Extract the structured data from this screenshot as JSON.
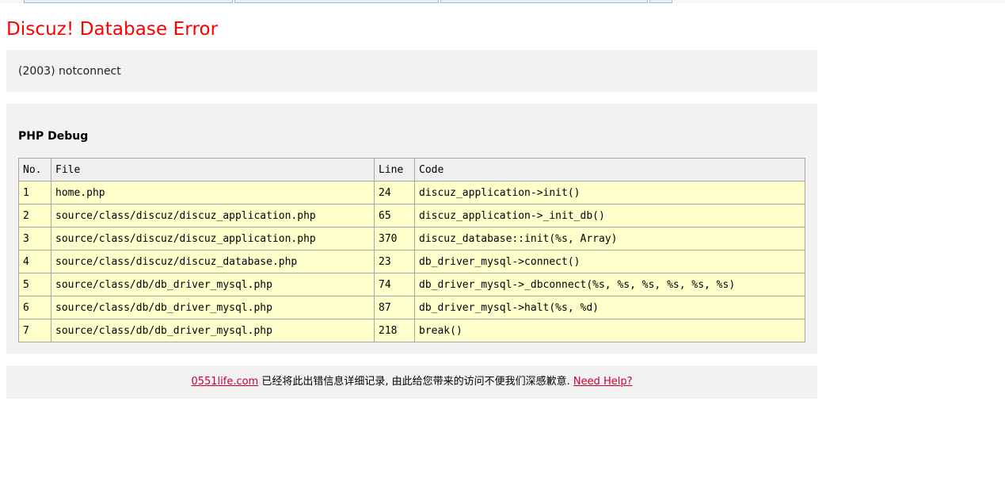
{
  "page": {
    "title": "Discuz! Database Error",
    "error_message": "(2003) notconnect"
  },
  "debug": {
    "title": "PHP Debug",
    "columns": [
      "No.",
      "File",
      "Line",
      "Code"
    ],
    "rows": [
      {
        "no": "1",
        "file": "home.php",
        "line": "24",
        "code": "discuz_application->init()"
      },
      {
        "no": "2",
        "file": "source/class/discuz/discuz_application.php",
        "line": "65",
        "code": "discuz_application->_init_db()"
      },
      {
        "no": "3",
        "file": "source/class/discuz/discuz_application.php",
        "line": "370",
        "code": "discuz_database::init(%s, Array)"
      },
      {
        "no": "4",
        "file": "source/class/discuz/discuz_database.php",
        "line": "23",
        "code": "db_driver_mysql->connect()"
      },
      {
        "no": "5",
        "file": "source/class/db/db_driver_mysql.php",
        "line": "74",
        "code": "db_driver_mysql->_dbconnect(%s, %s, %s, %s, %s, %s)"
      },
      {
        "no": "6",
        "file": "source/class/db/db_driver_mysql.php",
        "line": "87",
        "code": "db_driver_mysql->halt(%s, %d)"
      },
      {
        "no": "7",
        "file": "source/class/db/db_driver_mysql.php",
        "line": "218",
        "code": "break()"
      }
    ]
  },
  "footer": {
    "site_link": "0551life.com",
    "message": " 已经将此出错信息详细记录, 由此给您带来的访问不便我们深感歉意. ",
    "help_link": "Need Help?"
  },
  "colors": {
    "title": "#ff0000",
    "panel_bg": "#f2f2f2",
    "row_bg": "#ffffcc",
    "header_bg": "#efefef",
    "link": "#cc0033"
  }
}
